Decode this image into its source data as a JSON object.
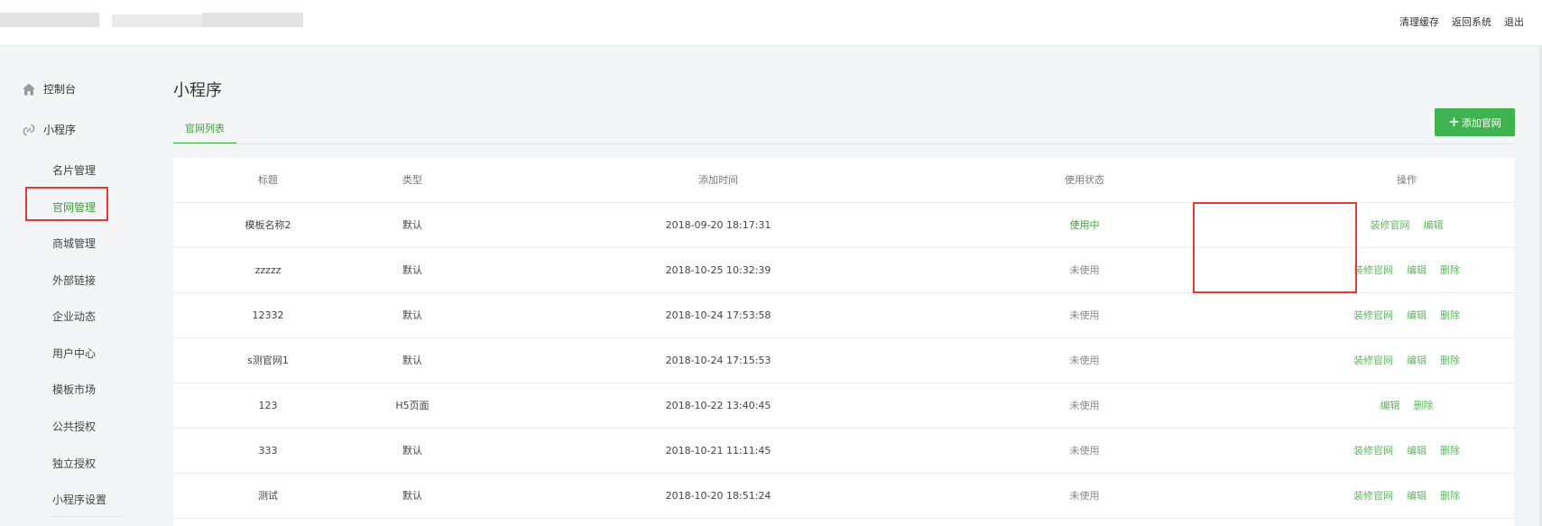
{
  "header": {
    "links": [
      "清理缓存",
      "返回系统",
      "退出"
    ]
  },
  "sidebar": {
    "dashboard": {
      "label": "控制台",
      "icon": "home-icon"
    },
    "miniprogram": {
      "label": "小程序",
      "icon": "link-icon"
    },
    "items": [
      "名片管理",
      "官网管理",
      "商城管理",
      "外部链接",
      "企业动态",
      "用户中心",
      "模板市场",
      "公共授权",
      "独立授权",
      "小程序设置"
    ],
    "active_index": 1
  },
  "main": {
    "title": "小程序",
    "tab": "官网列表",
    "add_button": "添加官网",
    "accent_color": "#3fb34f"
  },
  "table": {
    "headers": [
      "标题",
      "类型",
      "添加时间",
      "使用状态",
      "操作"
    ],
    "rows": [
      {
        "title": "模板名称2",
        "type": "默认",
        "time": "2018-09-20 18:17:31",
        "status": "使用中",
        "actions": [
          "装修官网",
          "编辑"
        ]
      },
      {
        "title": "zzzzz",
        "type": "默认",
        "time": "2018-10-25 10:32:39",
        "status": "未使用",
        "actions": [
          "装修官网",
          "编辑",
          "删除"
        ]
      },
      {
        "title": "12332",
        "type": "默认",
        "time": "2018-10-24 17:53:58",
        "status": "未使用",
        "actions": [
          "装修官网",
          "编辑",
          "删除"
        ]
      },
      {
        "title": "s测官网1",
        "type": "默认",
        "time": "2018-10-24 17:15:53",
        "status": "未使用",
        "actions": [
          "装修官网",
          "编辑",
          "删除"
        ]
      },
      {
        "title": "123",
        "type": "H5页面",
        "time": "2018-10-22 13:40:45",
        "status": "未使用",
        "actions": [
          "编辑",
          "删除"
        ]
      },
      {
        "title": "333",
        "type": "默认",
        "time": "2018-10-21 11:11:45",
        "status": "未使用",
        "actions": [
          "装修官网",
          "编辑",
          "删除"
        ]
      },
      {
        "title": "测试",
        "type": "默认",
        "time": "2018-10-20 18:51:24",
        "status": "未使用",
        "actions": [
          "装修官网",
          "编辑",
          "删除"
        ]
      }
    ]
  }
}
